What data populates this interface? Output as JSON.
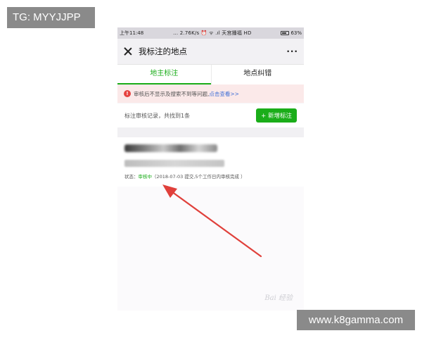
{
  "watermarks": {
    "top_left": "TG: MYYJJPP",
    "bottom_right": "www.k8gamma.com"
  },
  "status_bar": {
    "time": "上午11:48",
    "middle": "... 2.76K/s ⏰ ᯤ .ıl 天宫播福 HD",
    "battery": "63%"
  },
  "header": {
    "title": "我标注的地点",
    "close_icon": "close-icon",
    "more_label": "···"
  },
  "tabs": [
    {
      "label": "地主标注",
      "active": true
    },
    {
      "label": "地点纠错",
      "active": false
    }
  ],
  "notice": {
    "icon": "!",
    "text": "审核后不显示及搜索不到等问题,",
    "link": "点击查看>>"
  },
  "records": {
    "text": "标注审核记录，共找到1条",
    "add_button": "+ 新增标注"
  },
  "place": {
    "status_label": "状态：",
    "status_value": "审核中",
    "status_note": "（2018-07-03 提交,5个工作日内审核完成 ）"
  },
  "accent_color": "#1aad19",
  "arrow_color": "#e0403b"
}
